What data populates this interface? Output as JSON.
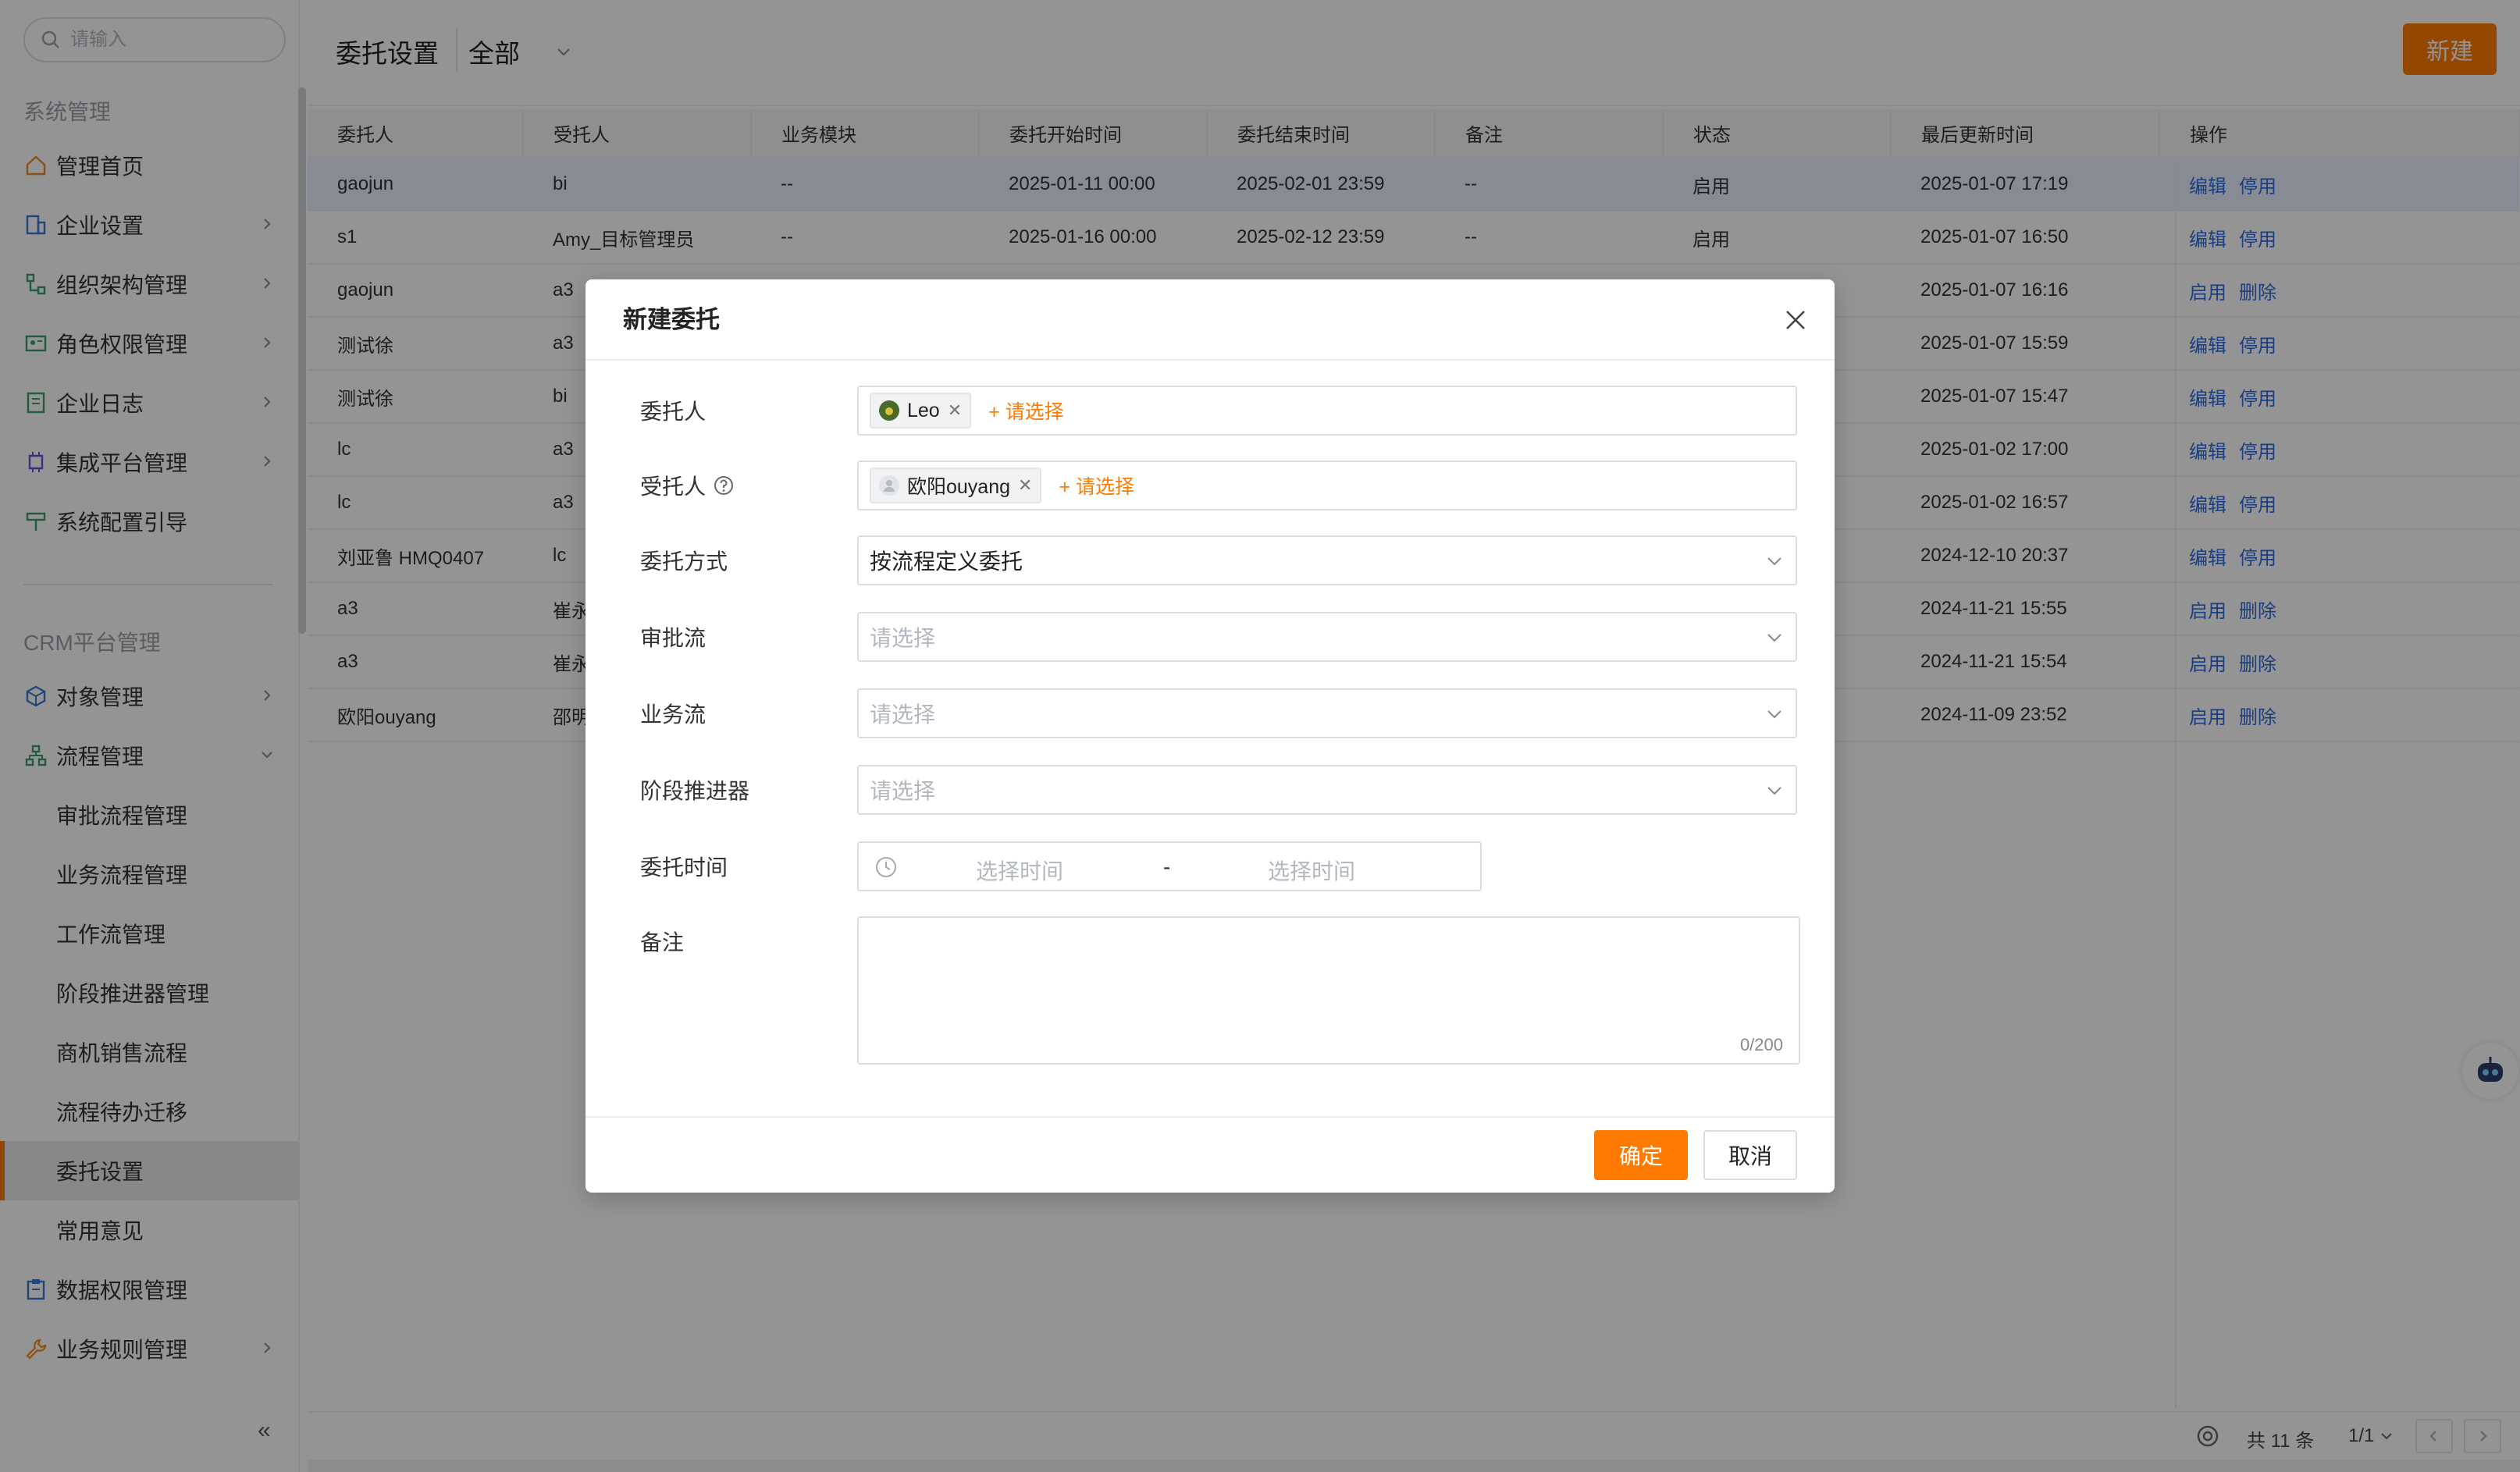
{
  "sidebar": {
    "search_placeholder": "请输入",
    "section_system": "系统管理",
    "system_items": [
      {
        "label": "管理首页"
      },
      {
        "label": "企业设置"
      },
      {
        "label": "组织架构管理"
      },
      {
        "label": "角色权限管理"
      },
      {
        "label": "企业日志"
      },
      {
        "label": "集成平台管理"
      },
      {
        "label": "系统配置引导"
      }
    ],
    "section_crm": "CRM平台管理",
    "crm_items": [
      {
        "label": "对象管理"
      },
      {
        "label": "流程管理"
      },
      {
        "label": "审批流程管理"
      },
      {
        "label": "业务流程管理"
      },
      {
        "label": "工作流管理"
      },
      {
        "label": "阶段推进器管理"
      },
      {
        "label": "商机销售流程"
      },
      {
        "label": "流程待办迁移"
      },
      {
        "label": "委托设置"
      },
      {
        "label": "常用意见"
      },
      {
        "label": "数据权限管理"
      },
      {
        "label": "业务规则管理"
      }
    ],
    "icon_colors": {
      "orange": "#f08a24",
      "blue": "#3a78d8",
      "green": "#3aa06a"
    }
  },
  "header": {
    "title": "委托设置",
    "filter": "全部",
    "new_button": "新建"
  },
  "table": {
    "columns": [
      "委托人",
      "受托人",
      "业务模块",
      "委托开始时间",
      "委托结束时间",
      "备注",
      "状态",
      "最后更新时间",
      "操作"
    ],
    "rows": [
      {
        "delegator": "gaojun",
        "delegate": "bi",
        "module": "--",
        "start": "2025-01-11 00:00",
        "end": "2025-02-01 23:59",
        "note": "--",
        "status": "启用",
        "updated": "2025-01-07 17:19",
        "op1": "编辑",
        "op2": "停用"
      },
      {
        "delegator": "s1",
        "delegate": "Amy_目标管理员",
        "module": "--",
        "start": "2025-01-16 00:00",
        "end": "2025-02-12 23:59",
        "note": "--",
        "status": "启用",
        "updated": "2025-01-07 16:50",
        "op1": "编辑",
        "op2": "停用"
      },
      {
        "delegator": "gaojun",
        "delegate": "a3",
        "module": "",
        "start": "",
        "end": "",
        "note": "",
        "status": "",
        "updated": "2025-01-07 16:16",
        "op1": "启用",
        "op2": "删除"
      },
      {
        "delegator": "测试徐",
        "delegate": "a3",
        "module": "",
        "start": "",
        "end": "",
        "note": "",
        "status": "",
        "updated": "2025-01-07 15:59",
        "op1": "编辑",
        "op2": "停用"
      },
      {
        "delegator": "测试徐",
        "delegate": "bi",
        "module": "",
        "start": "",
        "end": "",
        "note": "",
        "status": "",
        "updated": "2025-01-07 15:47",
        "op1": "编辑",
        "op2": "停用"
      },
      {
        "delegator": "lc",
        "delegate": "a3",
        "module": "",
        "start": "",
        "end": "",
        "note": "",
        "status": "",
        "updated": "2025-01-02 17:00",
        "op1": "编辑",
        "op2": "停用"
      },
      {
        "delegator": "lc",
        "delegate": "a3",
        "module": "",
        "start": "",
        "end": "",
        "note": "",
        "status": "",
        "updated": "2025-01-02 16:57",
        "op1": "编辑",
        "op2": "停用"
      },
      {
        "delegator": "刘亚鲁 HMQ0407",
        "delegate": "lc",
        "module": "",
        "start": "",
        "end": "",
        "note": "",
        "status": "",
        "updated": "2024-12-10 20:37",
        "op1": "编辑",
        "op2": "停用"
      },
      {
        "delegator": "a3",
        "delegate": "崔永",
        "module": "",
        "start": "",
        "end": "",
        "note": "",
        "status": "",
        "updated": "2024-11-21 15:55",
        "op1": "启用",
        "op2": "删除"
      },
      {
        "delegator": "a3",
        "delegate": "崔永",
        "module": "",
        "start": "",
        "end": "",
        "note": "",
        "status": "",
        "updated": "2024-11-21 15:54",
        "op1": "启用",
        "op2": "删除"
      },
      {
        "delegator": "欧阳ouyang",
        "delegate": "邵明",
        "module": "",
        "start": "",
        "end": "",
        "note": "",
        "status": "",
        "updated": "2024-11-09 23:52",
        "op1": "启用",
        "op2": "删除"
      }
    ]
  },
  "footer": {
    "total": "共 11 条",
    "page": "1/1"
  },
  "modal": {
    "title": "新建委托",
    "delegator_label": "委托人",
    "delegator_tag": "Leo",
    "add_select": "+ 请选择",
    "delegate_label": "受托人",
    "delegate_tag": "欧阳ouyang",
    "mode_label": "委托方式",
    "mode_value": "按流程定义委托",
    "approval_label": "审批流",
    "business_label": "业务流",
    "stage_label": "阶段推进器",
    "select_placeholder": "请选择",
    "time_label": "委托时间",
    "time_start_placeholder": "选择时间",
    "time_sep": "-",
    "time_end_placeholder": "选择时间",
    "note_label": "备注",
    "note_count": "0/200",
    "ok_button": "确定",
    "cancel_button": "取消"
  },
  "colors": {
    "accent": "#ff7a00",
    "link": "#2f6bdf",
    "selected_row": "#e8efff"
  }
}
